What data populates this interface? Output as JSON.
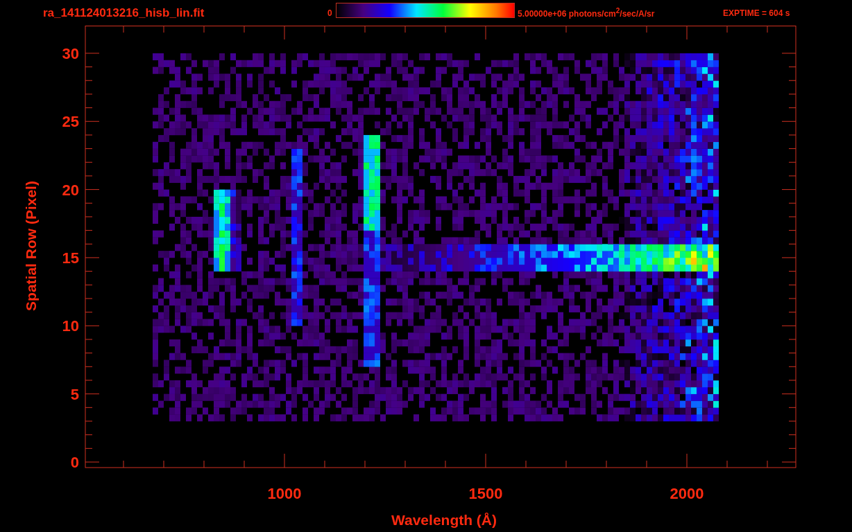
{
  "title": "ra_141124013216_hisb_lin.fit",
  "colorbar": {
    "min_label": "0",
    "max_label": "5.00000e+06 photons/cm$^{2}$/sec/A/sr"
  },
  "exposure": "EXPTIME = 604 s",
  "y_axis": {
    "label": "Spatial Row (Pixel)",
    "ticks": [
      "30",
      "25",
      "20",
      "15",
      "10",
      "5",
      "0"
    ]
  },
  "x_axis": {
    "label": "Wavelength (Å)",
    "ticks": [
      "1000",
      "1500",
      "2000"
    ]
  }
}
